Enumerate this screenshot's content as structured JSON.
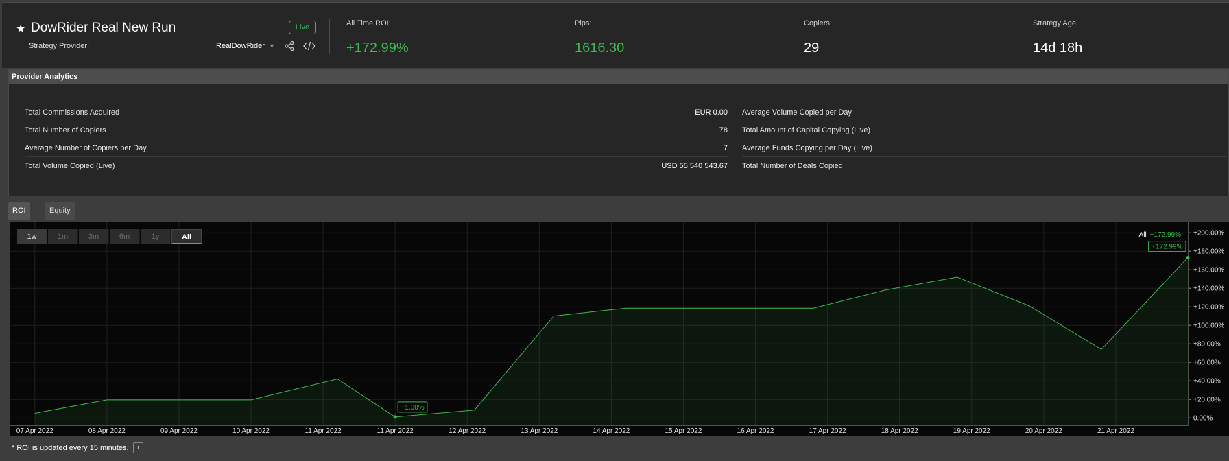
{
  "header": {
    "title": "DowRider Real New Run",
    "live_label": "Live",
    "provider_label": "Strategy Provider:",
    "provider_name": "RealDowRider",
    "stats": [
      {
        "label": "All Time ROI:",
        "value": "+172.99%",
        "color": "#3fb950"
      },
      {
        "label": "Pips:",
        "value": "1616.30",
        "color": "#3fb950"
      },
      {
        "label": "Copiers:",
        "value": "29",
        "color": "#ffffff"
      },
      {
        "label": "Strategy Age:",
        "value": "14d 18h",
        "color": "#ffffff"
      }
    ],
    "icons": [
      "star-icon",
      "caret-down-icon",
      "share-icon",
      "code-icon"
    ]
  },
  "analytics": {
    "title": "Provider Analytics",
    "left": [
      {
        "label": "Total Commissions Acquired",
        "value": "EUR 0.00"
      },
      {
        "label": "Total Number of Copiers",
        "value": "78"
      },
      {
        "label": "Average Number of Copiers per Day",
        "value": "7"
      },
      {
        "label": "Total Volume Copied (Live)",
        "value": "USD 55 540 543.67"
      }
    ],
    "right": [
      {
        "label": "Average Volume Copied per Day",
        "value": ""
      },
      {
        "label": "Total Amount of Capital Copying (Live)",
        "value": ""
      },
      {
        "label": "Average Funds Copying per Day (Live)",
        "value": ""
      },
      {
        "label": "Total Number of Deals Copied",
        "value": ""
      }
    ]
  },
  "tabs": [
    {
      "label": "ROI (%)",
      "active": true
    },
    {
      "label": "Equity",
      "active": false
    }
  ],
  "ranges": [
    {
      "label": "1w",
      "state": "selected"
    },
    {
      "label": "1m",
      "state": "disabled"
    },
    {
      "label": "3m",
      "state": "disabled"
    },
    {
      "label": "6m",
      "state": "disabled"
    },
    {
      "label": "1y",
      "state": "disabled"
    },
    {
      "label": "All",
      "state": "active"
    }
  ],
  "legend": {
    "label": "All",
    "value": "+172.99%"
  },
  "footer": {
    "note": "* ROI is updated every 15 minutes.",
    "info_icon": "i"
  },
  "chart_data": {
    "type": "area",
    "x": [
      "07 Apr 2022",
      "08 Apr 2022",
      "09 Apr 2022",
      "10 Apr 2022",
      "11 Apr 2022",
      "11 Apr 2022",
      "12 Apr 2022",
      "13 Apr 2022",
      "14 Apr 2022",
      "15 Apr 2022",
      "16 Apr 2022",
      "17 Apr 2022",
      "18 Apr 2022",
      "19 Apr 2022",
      "20 Apr 2022",
      "21 Apr 2022"
    ],
    "tick_labels": [
      "07 Apr 2022",
      "08 Apr 2022",
      "09 Apr 2022",
      "10 Apr 2022",
      "11 Apr 2022",
      "11 Apr 2022",
      "12 Apr 2022",
      "13 Apr 2022",
      "14 Apr 2022",
      "15 Apr 2022",
      "16 Apr 2022",
      "17 Apr 2022",
      "18 Apr 2022",
      "19 Apr 2022",
      "20 Apr 2022",
      "21 Apr 2022"
    ],
    "series": [
      {
        "points": [
          {
            "x": 0.0,
            "y": 5
          },
          {
            "x": 1.0,
            "y": 19.5
          },
          {
            "x": 3.0,
            "y": 19.5
          },
          {
            "x": 4.2,
            "y": 42
          },
          {
            "x": 5.0,
            "y": 1
          },
          {
            "x": 6.1,
            "y": 8.5
          },
          {
            "x": 7.2,
            "y": 110
          },
          {
            "x": 8.2,
            "y": 118.5
          },
          {
            "x": 10.8,
            "y": 118.5
          },
          {
            "x": 11.8,
            "y": 138
          },
          {
            "x": 12.8,
            "y": 152
          },
          {
            "x": 13.8,
            "y": 121
          },
          {
            "x": 14.8,
            "y": 74
          },
          {
            "x": 16.0,
            "y": 173
          }
        ],
        "color": "#3fb950"
      }
    ],
    "y_ticks": [
      "0.00%",
      "+20.00%",
      "+40.00%",
      "+60.00%",
      "+80.00%",
      "+100.00%",
      "+120.00%",
      "+140.00%",
      "+160.00%",
      "+180.00%",
      "+200.00%"
    ],
    "ylim": [
      -8,
      212
    ],
    "annotations": [
      {
        "text": "+1.00%",
        "x": 5.0,
        "y": 1
      },
      {
        "text": "+172.99%",
        "x": 16.0,
        "y": 173
      }
    ],
    "grid": true
  }
}
